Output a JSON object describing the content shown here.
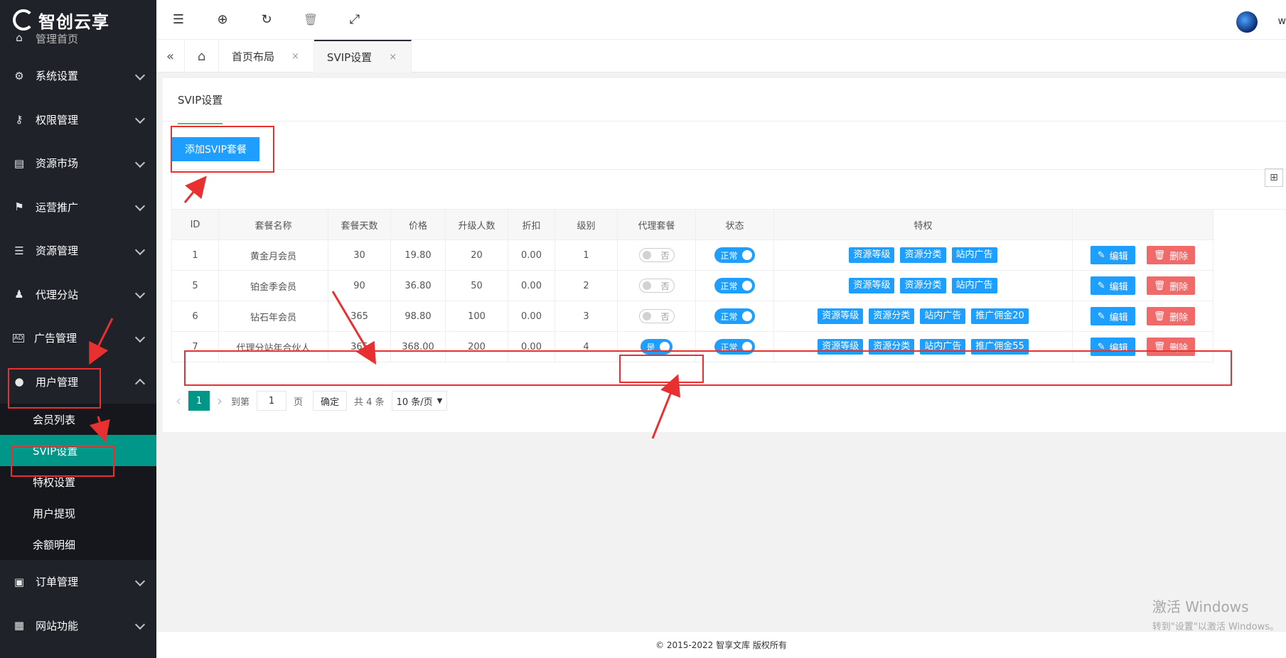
{
  "brand": {
    "name": "智创云享"
  },
  "sidebar": {
    "cut_item": "管理首页",
    "items": [
      {
        "label": "系统设置",
        "icon": "gear-icon"
      },
      {
        "label": "权限管理",
        "icon": "key-icon"
      },
      {
        "label": "资源市场",
        "icon": "store-icon"
      },
      {
        "label": "运营推广",
        "icon": "flag-icon"
      },
      {
        "label": "资源管理",
        "icon": "stack-icon"
      },
      {
        "label": "代理分站",
        "icon": "group-icon"
      },
      {
        "label": "广告管理",
        "icon": "ad-icon"
      },
      {
        "label": "用户管理",
        "icon": "user-icon"
      },
      {
        "label": "订单管理",
        "icon": "clipboard-icon"
      },
      {
        "label": "网站功能",
        "icon": "grid-icon"
      }
    ],
    "sub_items": [
      "会员列表",
      "SVIP设置",
      "特权设置",
      "用户提现",
      "余额明细"
    ]
  },
  "topbar": {
    "user_initial": "w"
  },
  "tabs": [
    {
      "label": "首页布局",
      "close": "×"
    },
    {
      "label": "SVIP设置",
      "close": "×"
    }
  ],
  "panel": {
    "tab_label": "SVIP设置",
    "add_button": "添加SVIP套餐"
  },
  "table": {
    "headers": [
      "ID",
      "套餐名称",
      "套餐天数",
      "价格",
      "升级人数",
      "折扣",
      "级别",
      "代理套餐",
      "状态",
      "特权",
      ""
    ],
    "rows": [
      {
        "id": "1",
        "name": "黄金月会员",
        "days": "30",
        "price": "19.80",
        "upgrade": "20",
        "discount": "0.00",
        "level": "1",
        "agent": "否",
        "status": "正常",
        "perks": [
          "资源等级",
          "资源分类",
          "站内广告"
        ]
      },
      {
        "id": "5",
        "name": "铂金季会员",
        "days": "90",
        "price": "36.80",
        "upgrade": "50",
        "discount": "0.00",
        "level": "2",
        "agent": "否",
        "status": "正常",
        "perks": [
          "资源等级",
          "资源分类",
          "站内广告"
        ]
      },
      {
        "id": "6",
        "name": "钻石年会员",
        "days": "365",
        "price": "98.80",
        "upgrade": "100",
        "discount": "0.00",
        "level": "3",
        "agent": "否",
        "status": "正常",
        "perks": [
          "资源等级",
          "资源分类",
          "站内广告",
          "推广佣金20"
        ]
      },
      {
        "id": "7",
        "name": "代理分站年合伙人",
        "days": "365",
        "price": "368.00",
        "upgrade": "200",
        "discount": "0.00",
        "level": "4",
        "agent": "是",
        "status": "正常",
        "perks": [
          "资源等级",
          "资源分类",
          "站内广告",
          "推广佣金55"
        ]
      }
    ],
    "actions": {
      "edit": "编辑",
      "delete": "删除"
    }
  },
  "pager": {
    "prev": "‹",
    "current": "1",
    "next": "›",
    "goto": "到第",
    "page_input": "1",
    "page_unit": "页",
    "confirm": "确定",
    "total": "共 4 条",
    "per_page": "10 条/页"
  },
  "footer": {
    "text": "© 2015-2022 智享文库 版权所有"
  },
  "watermark": {
    "line1": "激活 Windows",
    "line2": "转到\"设置\"以激活 Windows。"
  },
  "colors": {
    "sidebar": "#20222a",
    "active": "#009688",
    "primary": "#1e9fff",
    "danger": "#f06a6a",
    "highlight": "#e83030"
  }
}
